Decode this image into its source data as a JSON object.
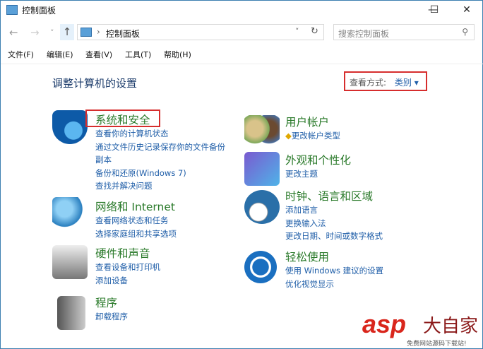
{
  "window": {
    "title": "控制面板",
    "min": "—",
    "max": "☐",
    "close": "✕"
  },
  "nav": {
    "back": "←",
    "forward": "→",
    "recent": "˅",
    "up": "↑",
    "sep": "›",
    "path": "控制面板",
    "dropdown": "˅",
    "refresh": "↻"
  },
  "search": {
    "placeholder": "搜索控制面板",
    "icon": "⚲"
  },
  "menu": [
    "文件(F)",
    "编辑(E)",
    "查看(V)",
    "工具(T)",
    "帮助(H)"
  ],
  "main": {
    "heading": "调整计算机的设置",
    "view_label": "查看方式:",
    "view_value": "类别",
    "view_arrow": "▾"
  },
  "categories": [
    {
      "title": "系统和安全",
      "links": [
        "查看你的计算机状态",
        "通过文件历史记录保存你的文件备份",
        "副本",
        "备份和还原(Windows 7)",
        "查找并解决问题"
      ]
    },
    {
      "title": "网络和 Internet",
      "links": [
        "查看网络状态和任务",
        "选择家庭组和共享选项"
      ]
    },
    {
      "title": "硬件和声音",
      "links": [
        "查看设备和打印机",
        "添加设备"
      ]
    },
    {
      "title": "程序",
      "links": [
        "卸载程序"
      ]
    },
    {
      "title": "用户帐户",
      "links": [
        "更改帐户类型"
      ]
    },
    {
      "title": "外观和个性化",
      "links": [
        "更改主题"
      ]
    },
    {
      "title": "时钟、语言和区域",
      "links": [
        "添加语言",
        "更换输入法",
        "更改日期、时间或数字格式"
      ]
    },
    {
      "title": "轻松使用",
      "links": [
        "使用 Windows 建议的设置",
        "优化视觉显示"
      ]
    }
  ],
  "watermark": {
    "brand": "asp",
    "chars": "大自家",
    "sub": "免费网站源码下载站!"
  }
}
